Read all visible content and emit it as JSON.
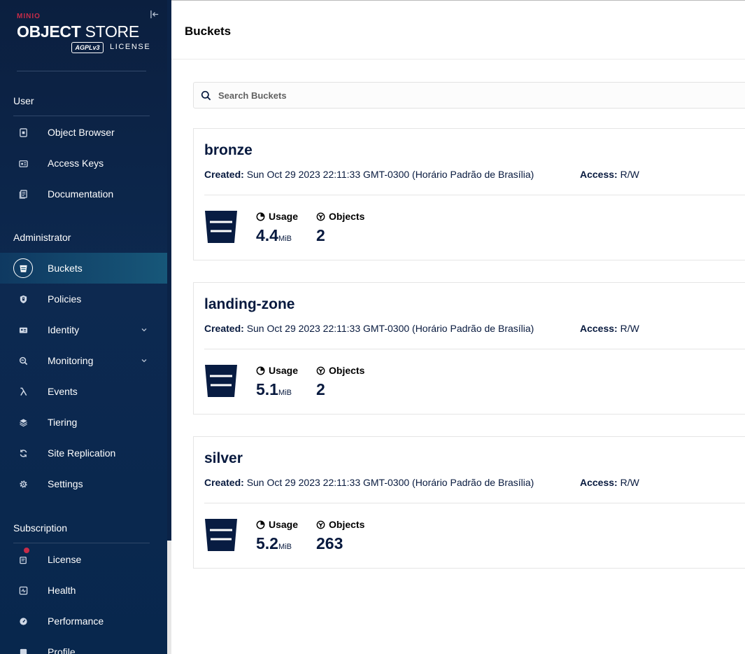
{
  "brand": {
    "minio": "MINIO",
    "title_bold": "OBJECT",
    "title_light": "STORE",
    "agpl": "AGPLv3",
    "license": "LICENSE"
  },
  "sidebar": {
    "sections": [
      {
        "title": "User"
      },
      {
        "title": "Administrator"
      },
      {
        "title": "Subscription"
      }
    ],
    "user_items": [
      {
        "label": "Object Browser",
        "icon": "object-browser-icon"
      },
      {
        "label": "Access Keys",
        "icon": "access-keys-icon"
      },
      {
        "label": "Documentation",
        "icon": "documentation-icon"
      }
    ],
    "admin_items": [
      {
        "label": "Buckets",
        "icon": "bucket-icon",
        "active": true
      },
      {
        "label": "Policies",
        "icon": "shield-icon"
      },
      {
        "label": "Identity",
        "icon": "id-card-icon",
        "expandable": true
      },
      {
        "label": "Monitoring",
        "icon": "monitor-search-icon",
        "expandable": true
      },
      {
        "label": "Events",
        "icon": "lambda-icon"
      },
      {
        "label": "Tiering",
        "icon": "layers-icon"
      },
      {
        "label": "Site Replication",
        "icon": "sync-icon"
      },
      {
        "label": "Settings",
        "icon": "gear-icon"
      }
    ],
    "subscription_items": [
      {
        "label": "License",
        "icon": "license-icon",
        "badge": true
      },
      {
        "label": "Health",
        "icon": "health-icon"
      },
      {
        "label": "Performance",
        "icon": "speedometer-icon"
      },
      {
        "label": "Profile",
        "icon": "profile-icon"
      }
    ]
  },
  "page": {
    "title": "Buckets"
  },
  "search": {
    "placeholder": "Search Buckets",
    "value": ""
  },
  "labels": {
    "created": "Created:",
    "access": "Access:",
    "usage": "Usage",
    "objects": "Objects"
  },
  "buckets": [
    {
      "name": "bronze",
      "created": "Sun Oct 29 2023 22:11:33 GMT-0300 (Horário Padrão de Brasília)",
      "access": "R/W",
      "usage_value": "4.4",
      "usage_unit": "MiB",
      "objects": "2"
    },
    {
      "name": "landing-zone",
      "created": "Sun Oct 29 2023 22:11:33 GMT-0300 (Horário Padrão de Brasília)",
      "access": "R/W",
      "usage_value": "5.1",
      "usage_unit": "MiB",
      "objects": "2"
    },
    {
      "name": "silver",
      "created": "Sun Oct 29 2023 22:11:33 GMT-0300 (Horário Padrão de Brasília)",
      "access": "R/W",
      "usage_value": "5.2",
      "usage_unit": "MiB",
      "objects": "263"
    }
  ],
  "colors": {
    "sidebar_bg": "#0d2950",
    "active_item": "#175779",
    "brand_red": "#c72c48",
    "text_dark": "#07193e"
  }
}
